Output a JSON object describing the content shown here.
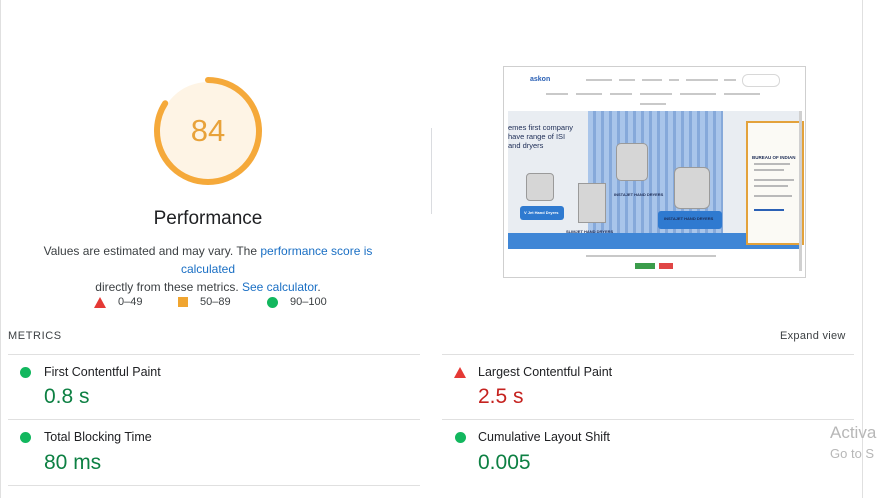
{
  "performance": {
    "score": "84",
    "score_fraction": 0.84,
    "title": "Performance",
    "desc_prefix": "Values are estimated and may vary. The ",
    "desc_link1": "performance score is calculated",
    "desc_middle": " directly from these metrics. ",
    "desc_link2": "See calculator",
    "desc_suffix": "."
  },
  "legend": {
    "poor": "0–49",
    "average": "50–89",
    "good": "90–100"
  },
  "thumbnail": {
    "logo": "askon",
    "hero_text": "emes first company have range of ISI and dryers",
    "captions": [
      "V Jet Hand Dryers",
      "SLIMJET HAND DRYERS",
      "INSTAJET HAND DRYERS",
      "INSTAJET HAND DRYERS"
    ],
    "cert_title": "BUREAU OF INDIAN"
  },
  "metrics": {
    "label": "METRICS",
    "expand": "Expand view",
    "items": [
      {
        "name": "First Contentful Paint",
        "value": "0.8 s",
        "status": "good"
      },
      {
        "name": "Largest Contentful Paint",
        "value": "2.5 s",
        "status": "poor"
      },
      {
        "name": "Total Blocking Time",
        "value": "80 ms",
        "status": "good"
      },
      {
        "name": "Cumulative Layout Shift",
        "value": "0.005",
        "status": "good"
      }
    ]
  },
  "colors": {
    "good": "#0d8043",
    "poor": "#c5221f",
    "average": "#e8a23a",
    "link": "#1a6fc4"
  },
  "watermark": {
    "line1": "Activa",
    "line2": "Go to S"
  }
}
